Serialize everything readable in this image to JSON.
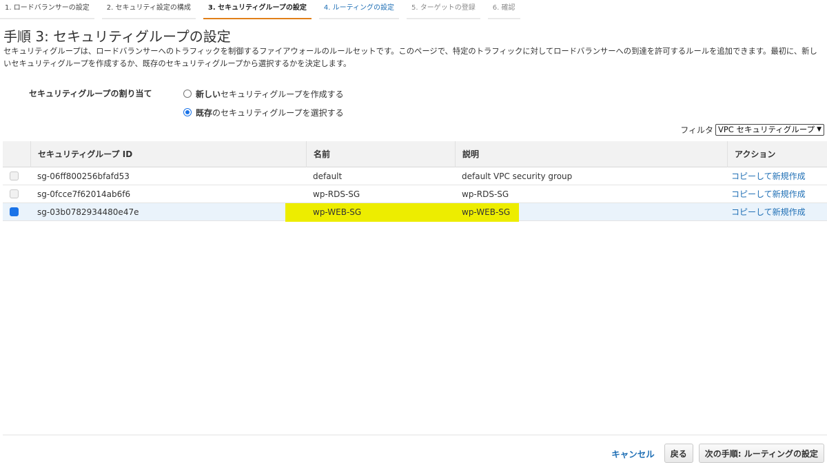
{
  "wizard": {
    "steps": [
      {
        "label": "1. ロードバランサーの設定"
      },
      {
        "label": "2. セキュリティ設定の構成"
      },
      {
        "label": "3. セキュリティグループの設定"
      },
      {
        "label": "4. ルーティングの設定"
      },
      {
        "label": "5. ターゲットの登録"
      },
      {
        "label": "6. 確認"
      }
    ]
  },
  "page": {
    "title": "手順 3: セキュリティグループの設定",
    "description": "セキュリティグループは、ロードバランサーへのトラフィックを制御するファイアウォールのルールセットです。このページで、特定のトラフィックに対してロードバランサーへの到達を許可するルールを追加できます。最初に、新しいセキュリティグループを作成するか、既存のセキュリティグループから選択するかを決定します。"
  },
  "assignment": {
    "label": "セキュリティグループの割り当て",
    "options": [
      {
        "bold": "新しい",
        "rest": "セキュリティグループを作成する",
        "selected": false
      },
      {
        "bold": "既存",
        "rest": "のセキュリティグループを選択する",
        "selected": true
      }
    ]
  },
  "filter": {
    "label": "フィルタ",
    "selected": "VPC セキュリティグループ"
  },
  "table": {
    "columns": [
      "セキュリティグループ ID",
      "名前",
      "説明",
      "アクション"
    ],
    "rows": [
      {
        "id": "sg-06ff800256bfafd53",
        "name": "default",
        "description": "default VPC security group",
        "action": "コピーして新規作成",
        "checked": false
      },
      {
        "id": "sg-0fcce7f62014ab6f6",
        "name": "wp-RDS-SG",
        "description": "wp-RDS-SG",
        "action": "コピーして新規作成",
        "checked": false
      },
      {
        "id": "sg-03b0782934480e47e",
        "name": "wp-WEB-SG",
        "description": "wp-WEB-SG",
        "action": "コピーして新規作成",
        "checked": true
      }
    ]
  },
  "footer": {
    "cancel": "キャンセル",
    "back": "戻る",
    "next": "次の手順: ルーティングの設定"
  },
  "colors": {
    "accent": "#1f6fb5",
    "current_step_underline": "#e07f18",
    "highlight": "#eded00"
  }
}
